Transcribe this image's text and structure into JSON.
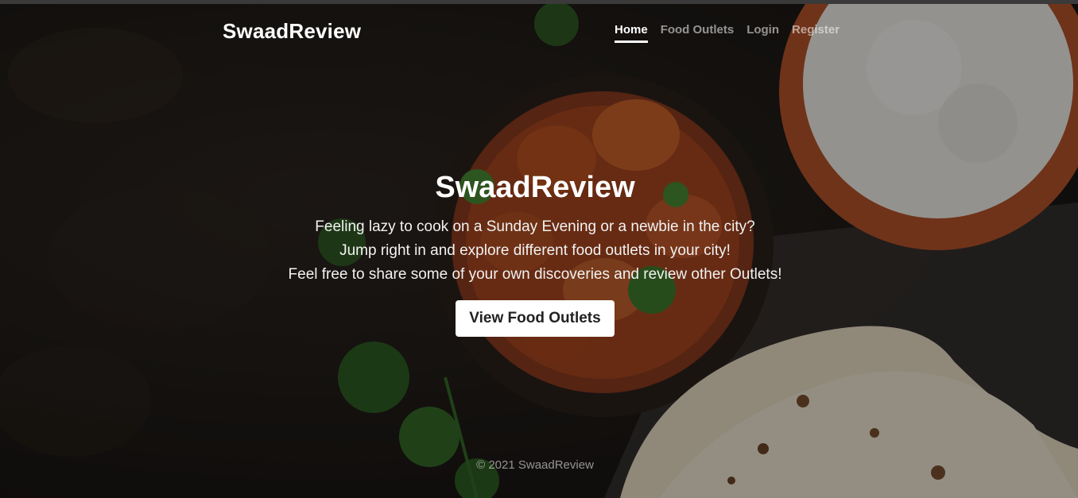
{
  "navbar": {
    "brand": "SwaadReview",
    "links": [
      {
        "label": "Home",
        "active": true
      },
      {
        "label": "Food Outlets",
        "active": false
      },
      {
        "label": "Login",
        "active": false
      },
      {
        "label": "Register",
        "active": false
      }
    ]
  },
  "hero": {
    "title": "SwaadReview",
    "lines": [
      "Feeling lazy to cook on a Sunday Evening or a newbie in the city?",
      "Jump right in and explore different food outlets in your city!",
      "Feel free to share some of your own discoveries and review other Outlets!"
    ],
    "cta_label": "View Food Outlets",
    "background": "food-photo-curry-rice-naan"
  },
  "footer": {
    "copyright": "© 2021 SwaadReview"
  },
  "colors": {
    "accent": "#ffffff",
    "text_muted": "#9a9a9a",
    "background": "#1d1916"
  }
}
